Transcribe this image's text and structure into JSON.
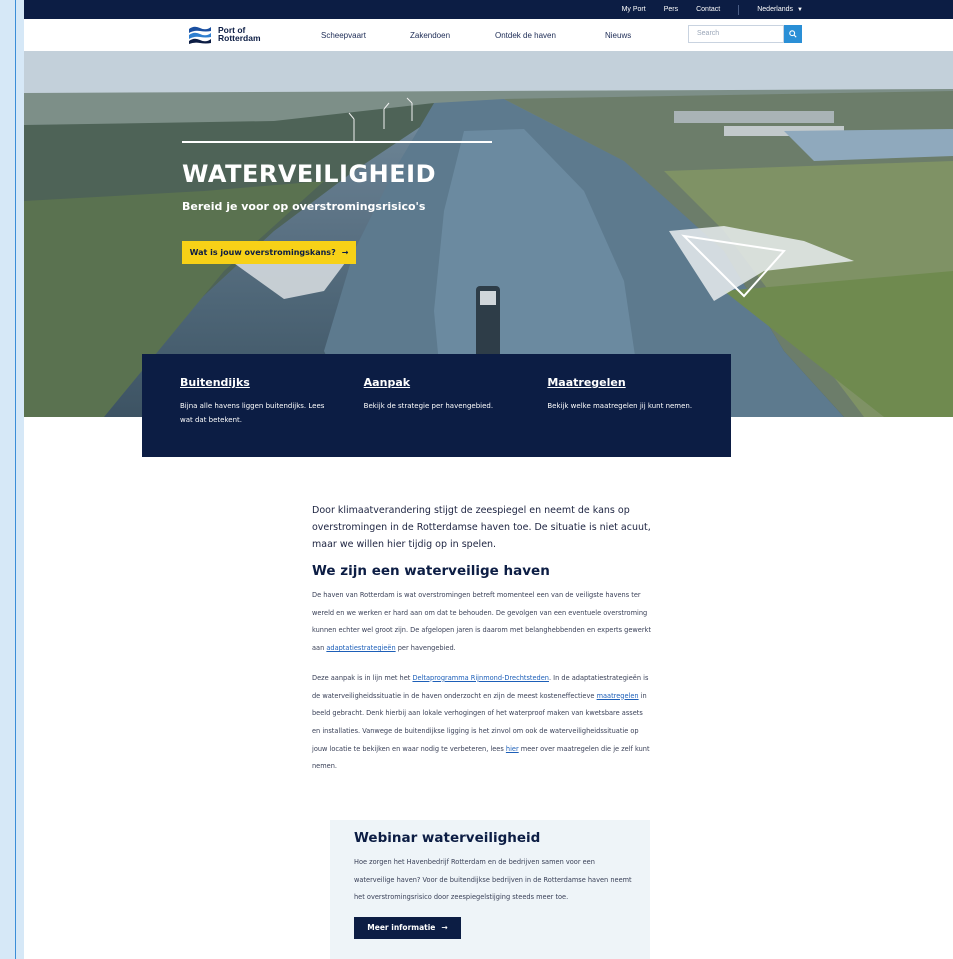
{
  "utility": {
    "my_port": "My Port",
    "press": "Pers",
    "contact": "Contact",
    "language": "Nederlands"
  },
  "logo": {
    "line1": "Port of",
    "line2": "Rotterdam"
  },
  "nav": {
    "items": [
      "Scheepvaart",
      "Zakendoen",
      "Ontdek de haven",
      "Nieuws"
    ]
  },
  "search": {
    "placeholder": "Search"
  },
  "hero": {
    "title": "WATERVEILIGHEID",
    "subtitle": "Bereid je voor op overstromingsrisico's",
    "cta": "Wat is jouw overstromingskans?",
    "cta_arrow": "→"
  },
  "cards": [
    {
      "title": "Buitendijks",
      "text": "Bijna alle havens liggen buitendijks. Lees wat dat betekent."
    },
    {
      "title": "Aanpak",
      "text": "Bekijk de strategie per havengebied."
    },
    {
      "title": "Maatregelen",
      "text": "Bekijk welke maatregelen jij kunt nemen."
    }
  ],
  "article": {
    "intro": "Door klimaatverandering stijgt de zeespiegel en neemt de kans op overstromingen in de Rotterdamse haven toe. De situatie is niet acuut, maar we willen hier tijdig op in spelen.",
    "heading": "We zijn een waterveilige haven",
    "p1_before": "De haven van Rotterdam is wat overstromingen betreft momenteel een van de veiligste havens ter wereld en we werken er hard aan om dat te behouden. De gevolgen van een eventuele overstroming kunnen echter wel groot zijn. De afgelopen jaren is daarom met belanghebbenden en experts gewerkt aan ",
    "p1_link": "adaptatiestrategieën",
    "p1_after": " per havengebied.",
    "p2_a": "Deze aanpak is in lijn met het ",
    "p2_link1": "Deltaprogramma Rijnmond-Drechtsteden",
    "p2_b": ". In de adaptatiestrategieën is de waterveiligheidssituatie in de haven onderzocht en zijn de meest kosteneffectieve ",
    "p2_link2": "maatregelen",
    "p2_c": " in beeld gebracht. Denk hierbij aan lokale verhogingen of het waterproof maken van kwetsbare assets en installaties. Vanwege de buitendijkse ligging is het zinvol om ook de waterveiligheidssituatie op jouw locatie te bekijken en waar nodig te verbeteren, lees ",
    "p2_link3": "hier",
    "p2_d": " meer over maatregelen die je zelf kunt nemen."
  },
  "webinar": {
    "title": "Webinar waterveiligheid",
    "text": "Hoe zorgen het Havenbedrijf Rotterdam en de bedrijven samen voor een waterveilige haven? Voor de buitendijkse bedrijven in de Rotterdamse haven neemt het overstromingsrisico door zeespiegelstijging steeds meer toe.",
    "button": "Meer informatie",
    "button_arrow": "→"
  },
  "colors": {
    "navy": "#0c1d44",
    "yellow": "#f7d117",
    "search_blue": "#2a8fd6",
    "link_blue": "#1d5fb8"
  }
}
